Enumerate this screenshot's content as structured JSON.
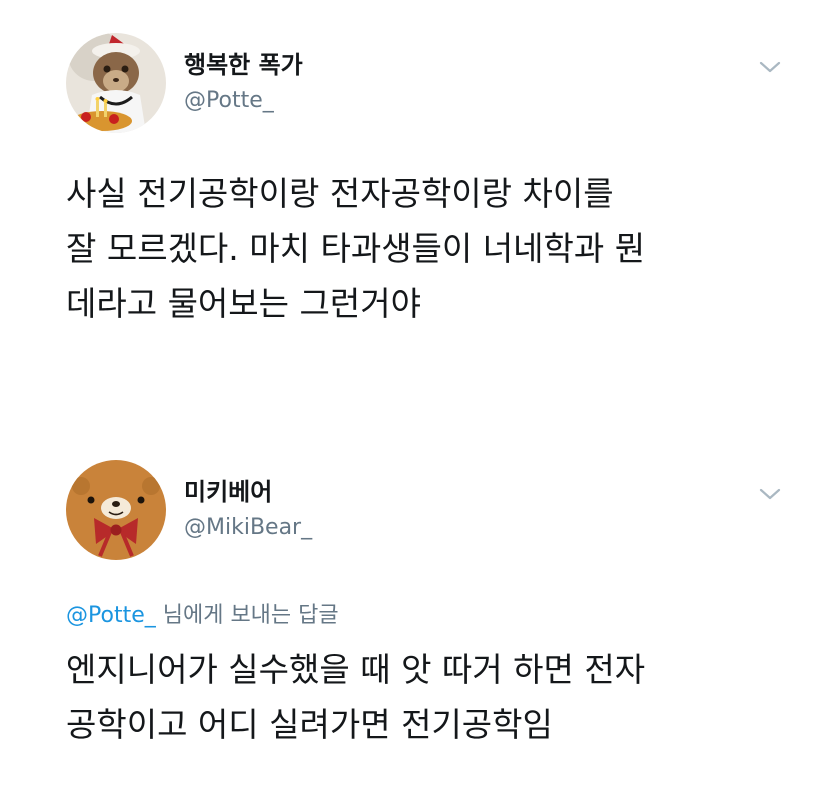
{
  "tweets": [
    {
      "display_name": "행복한 폭가",
      "handle": "@Potte_",
      "avatar_icon": "cat-with-birthday-cake-avatar",
      "menu_icon": "chevron-down-icon",
      "body_lines": [
        "사실 전기공학이랑 전자공학이랑 차이를",
        "잘 모르겠다. 마치 타과생들이 너네학과 뭔",
        "데라고 물어보는 그런거야"
      ]
    },
    {
      "display_name": "미키베어",
      "handle": "@MikiBear_",
      "avatar_icon": "bear-with-bowtie-avatar",
      "menu_icon": "chevron-down-icon",
      "reply_to": {
        "handle": "@Potte_",
        "suffix": " 님에게 보내는 답글"
      },
      "body_lines": [
        "엔지니어가 실수했을 때 앗 따거 하면 전자",
        "공학이고 어디 실려가면 전기공학임"
      ]
    }
  ],
  "colors": {
    "text": "#14171a",
    "secondary": "#657786",
    "link": "#1b95e0",
    "chevron": "#aab8c2",
    "bear_fur": "#c9833a",
    "bowtie": "#b72a2a"
  }
}
